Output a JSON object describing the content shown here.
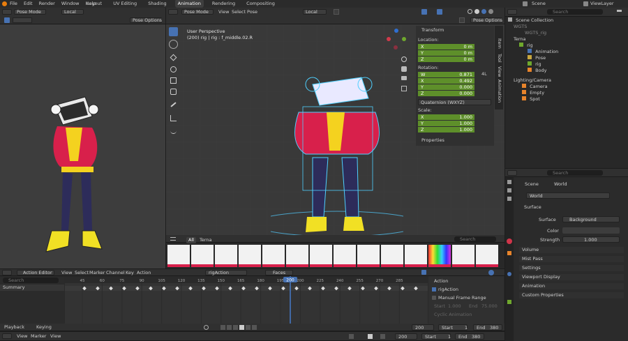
{
  "topbar": {
    "menus": [
      "File",
      "Edit",
      "Render",
      "Window",
      "Help"
    ],
    "workspaces": [
      "Layout",
      "UV Editing",
      "Shading",
      "Animation",
      "Rendering",
      "Compositing"
    ],
    "active_workspace": "Animation",
    "scene": "Scene",
    "view_layer": "ViewLayer"
  },
  "left_viewport": {
    "mode": "Pose Mode",
    "orientation": "Local",
    "pose_options": "Pose Options"
  },
  "main_viewport": {
    "mode": "Pose Mode",
    "menus": [
      "View",
      "Select",
      "Pose"
    ],
    "orientation": "Local",
    "pose_options": "Pose Options",
    "overlay_line1": "User Perspective",
    "overlay_line2": "(200) rig | rig : f_middle.02.R",
    "side_tabs": [
      "Item",
      "Tool",
      "View",
      "Animation"
    ]
  },
  "transform_panel": {
    "title": "Transform",
    "location_label": "Location:",
    "location": [
      {
        "axis": "X",
        "value": "0 m"
      },
      {
        "axis": "Y",
        "value": "0 m"
      },
      {
        "axis": "Z",
        "value": "0 m"
      }
    ],
    "rotation_label": "Rotation:",
    "rotation_mode_label": "4L",
    "rotation": [
      {
        "axis": "W",
        "value": "0.871"
      },
      {
        "axis": "X",
        "value": "0.492"
      },
      {
        "axis": "Y",
        "value": "0.000"
      },
      {
        "axis": "Z",
        "value": "0.000"
      }
    ],
    "rotation_mode": "Quaternion (WXYZ)",
    "scale_label": "Scale:",
    "scale": [
      {
        "axis": "X",
        "value": "1.000"
      },
      {
        "axis": "Y",
        "value": "1.000"
      },
      {
        "axis": "Z",
        "value": "1.000"
      }
    ],
    "properties": "Properties"
  },
  "pose_library": {
    "tabs": [
      "All",
      "Terna"
    ],
    "search_placeholder": "Search"
  },
  "outliner": {
    "search_placeholder": "Search",
    "root": "Scene Collection",
    "items": [
      {
        "label": "WGTS",
        "depth": 1
      },
      {
        "label": "WGTS_rig",
        "depth": 2
      },
      {
        "label": "Terna",
        "depth": 1
      },
      {
        "label": "rig",
        "depth": 2
      },
      {
        "label": "Animation",
        "depth": 3
      },
      {
        "label": "Pose",
        "depth": 3
      },
      {
        "label": "rig",
        "depth": 3
      },
      {
        "label": "Body",
        "depth": 3
      },
      {
        "label": "Lighting/Camera",
        "depth": 1
      },
      {
        "label": "Camera",
        "depth": 2
      },
      {
        "label": "Empty",
        "depth": 2
      },
      {
        "label": "Spot",
        "depth": 2
      }
    ]
  },
  "properties_editor": {
    "search_placeholder": "Search",
    "breadcrumb_scene": "Scene",
    "breadcrumb_world": "World",
    "world_name": "World",
    "surface_section": "Surface",
    "surface_label": "Surface",
    "surface_value": "Background",
    "color_label": "Color",
    "strength_label": "Strength",
    "strength_value": "1.000",
    "sections": [
      "Volume",
      "Mist Pass",
      "Settings",
      "Viewport Display",
      "Animation",
      "Custom Properties"
    ]
  },
  "action_editor": {
    "editor": "Action Editor",
    "menus": [
      "View",
      "Select",
      "Marker",
      "Channel",
      "Key",
      "Action"
    ],
    "action": "rigAction",
    "only_selected": "Faces",
    "search_placeholder": "Search",
    "summary": "Summary",
    "ruler": [
      "45",
      "60",
      "75",
      "90",
      "105",
      "120",
      "135",
      "150",
      "165",
      "180",
      "195",
      "200",
      "225",
      "240",
      "255",
      "270",
      "285"
    ],
    "current_frame": "200",
    "side_panel": {
      "title": "Action",
      "action_name": "rigAction",
      "manual_range": "Manual Frame Range",
      "start_label": "Start",
      "start_value": "1.000",
      "end_label": "End",
      "end_value": "75.000",
      "cyclic": "Cyclic Animation"
    }
  },
  "playback": {
    "playback": "Playback",
    "keying": "Keying",
    "frame": "200",
    "start_label": "Start",
    "start": "1",
    "end_label": "End",
    "end": "380"
  },
  "timeline": {
    "menus": [
      "View",
      "Marker",
      "View"
    ],
    "frame": "200",
    "start_label": "Start",
    "start": "1",
    "end_label": "End",
    "end": "380"
  },
  "colors": {
    "accent_blue": "#4772b3",
    "field_green": "#5e8f2a",
    "playhead": "#4b8df0"
  }
}
